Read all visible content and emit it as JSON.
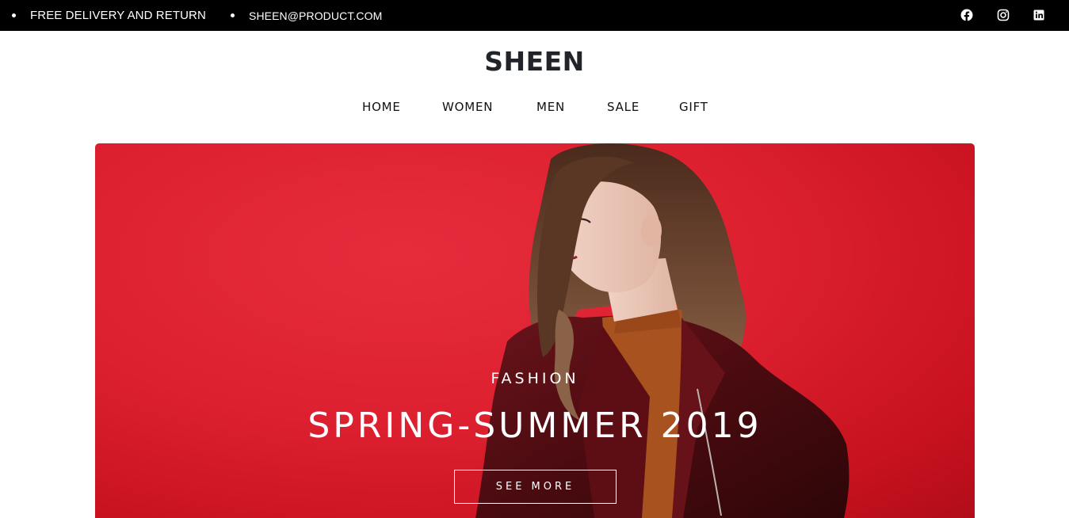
{
  "topbar": {
    "delivery_text": "FREE DELIVERY AND RETURN",
    "email_text": "SHEEN@PRODUCT.COM",
    "social": [
      {
        "icon": "facebook-icon"
      },
      {
        "icon": "instagram-icon"
      },
      {
        "icon": "linkedin-icon"
      }
    ]
  },
  "header": {
    "brand": "SHEEN",
    "nav": [
      "HOME",
      "WOMEN",
      "MEN",
      "SALE",
      "GIFT"
    ]
  },
  "hero": {
    "eyebrow": "FASHION",
    "title": "SPRING-SUMMER 2019",
    "button_label": "SEE MORE",
    "colors": {
      "background": "#dd2030",
      "jacket": "#5a0f14",
      "sweater": "#a8521f"
    }
  }
}
